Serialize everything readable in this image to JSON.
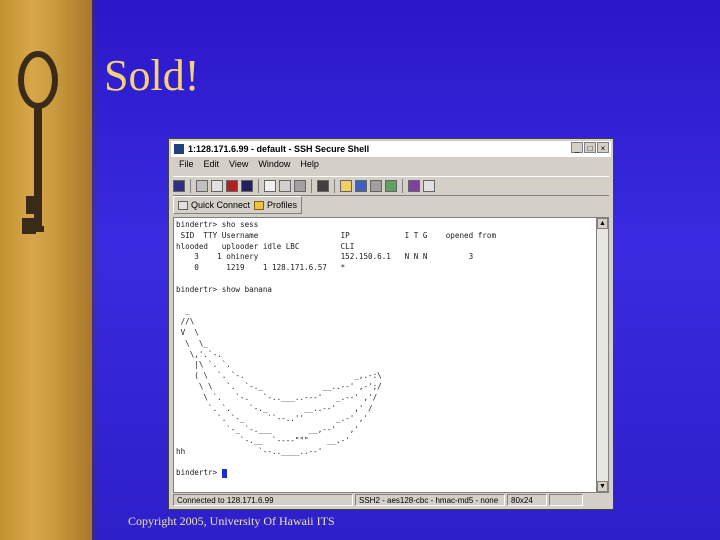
{
  "slide": {
    "title": "Sold!",
    "copyright": "Copyright 2005, University Of Hawaii ITS"
  },
  "window": {
    "title": "1:128.171.6.99 - default - SSH Secure Shell",
    "menu": [
      "File",
      "Edit",
      "View",
      "Window",
      "Help"
    ],
    "quick_connect": "Quick Connect",
    "profiles": "Profiles",
    "terminal_lines": [
      "bindertr> sho sess",
      " SID  TTY Username                  IP            I T G    opened from",
      "hlooded   uplooder idle LBC         CLI",
      "    3    1 ohinery                  152.150.6.1   N N N         3",
      "    0      1219    1 128.171.6.57   *",
      "",
      "bindertr> show banana",
      "",
      "  _",
      " //\\",
      " V  \\",
      "  \\  \\_",
      "   \\,'.`-.",
      "    |\\ `. `.",
      "    ( \\  `. `-.                        _,.-:\\",
      "     \\ \\   `.  `-._             __..--' ,-';/",
      "      \\ `.   `-.   `-..___..---'   _.--' ,'/",
      "       `. `.    `-._        __..--'    ,' /",
      "         `. `-_     ``--..''       _.-' ,'",
      "           `-_ `-.___        __,--'   ,'",
      "              `-.__  `----\"\"\"    __.-'",
      "hh                `--..____..--'",
      "",
      "bindertr> "
    ],
    "status": {
      "connection": "Connected to 128.171.6.99",
      "cipher": "SSH2 - aes128-cbc - hmac-md5 - none",
      "size": "80x24"
    }
  }
}
